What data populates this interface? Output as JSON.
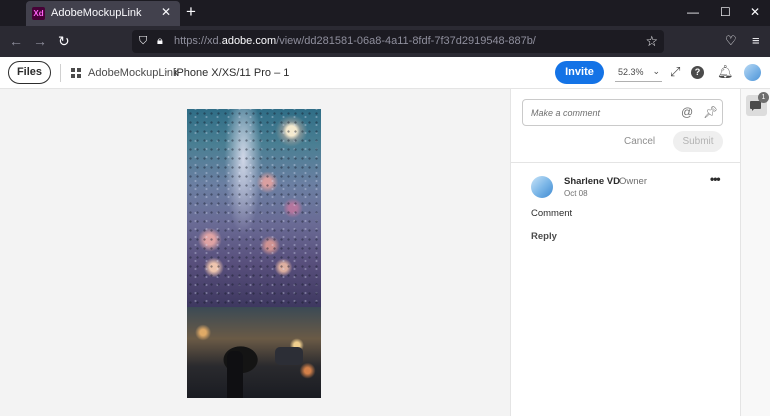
{
  "browser": {
    "tab_title": "AdobeMockupLink",
    "tab_icon_text": "Xd",
    "close_glyph": "✕",
    "new_tab_glyph": "+",
    "url_prefix": "https://xd.",
    "url_domain": "adobe.com",
    "url_path": "/view/dd281581-06a8-4a11-8fdf-7f37d2919548-887b/",
    "window_controls": {
      "minimize": "—",
      "maximize": "☐",
      "close": "✕"
    },
    "icons": [
      "back-icon",
      "forward-icon",
      "reload-icon",
      "shield-icon",
      "lock-icon",
      "bookmark-star-icon",
      "pocket-icon",
      "menu-icon"
    ]
  },
  "header": {
    "files_label": "Files",
    "breadcrumb_project": "AdobeMockupLink",
    "breadcrumb_sep": "›",
    "breadcrumb_artboard": "iPhone X/XS/11 Pro – 1",
    "invite_label": "Invite",
    "zoom_value": "52.3%",
    "help_glyph": "?",
    "accent_color": "#1473e6"
  },
  "comments": {
    "placeholder": "Make a comment",
    "at_glyph": "@",
    "cancel_label": "Cancel",
    "submit_label": "Submit",
    "items": [
      {
        "author": "Sharlene VD",
        "role": "Owner",
        "date": "Oct 08",
        "text": "Comment",
        "reply_label": "Reply"
      }
    ]
  },
  "rail": {
    "badge_count": "1"
  }
}
